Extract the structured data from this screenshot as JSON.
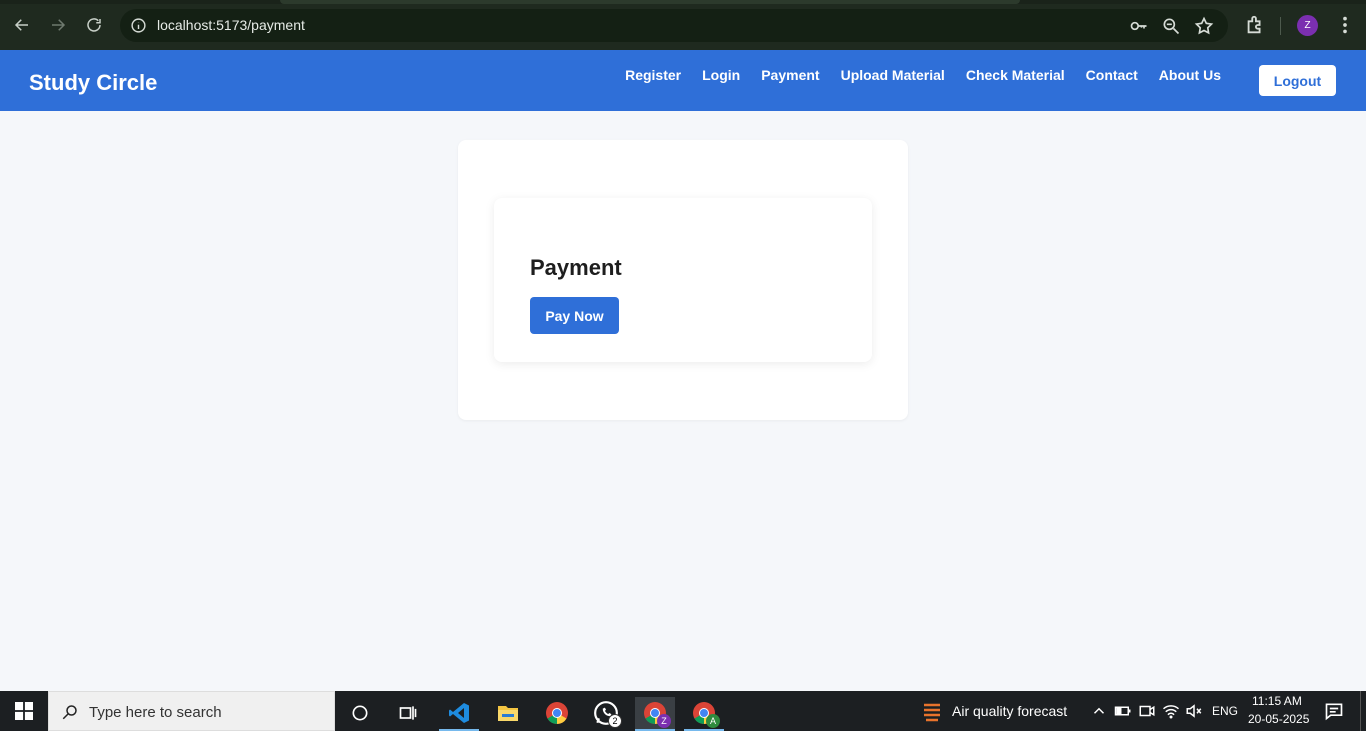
{
  "browser": {
    "url": "localhost:5173/payment",
    "profile_initial": "Z"
  },
  "navbar": {
    "brand": "Study Circle",
    "links": [
      "Register",
      "Login",
      "Payment",
      "Upload Material",
      "Check Material",
      "Contact",
      "About Us"
    ],
    "logout_label": "Logout",
    "color": "#2f6fd8"
  },
  "payment": {
    "title": "Payment",
    "pay_button_label": "Pay Now"
  },
  "taskbar": {
    "search_placeholder": "Type here to search",
    "whatsapp_badge": "2",
    "chrome_profile_badge": "Z",
    "chrome_profile_badge_2": "A",
    "weather_label": "Air quality forecast",
    "language": "ENG",
    "time": "11:15 AM",
    "date": "20-05-2025"
  }
}
